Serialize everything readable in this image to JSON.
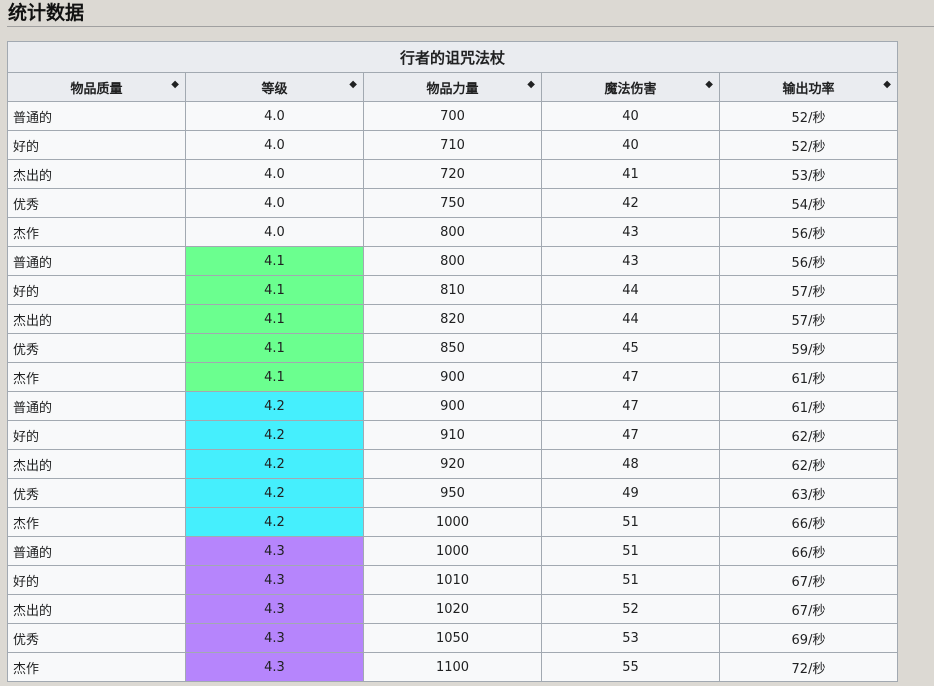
{
  "section_title": "统计数据",
  "table": {
    "title": "行者的诅咒法杖",
    "headers": [
      "物品质量",
      "等级",
      "物品力量",
      "魔法伤害",
      "输出功率"
    ],
    "level_colors": {
      "4.0": "",
      "4.1": "#6bff8f",
      "4.2": "#45effd",
      "4.3": "#b685fc"
    },
    "rows": [
      [
        "普通的",
        "4.0",
        "700",
        "40",
        "52/秒"
      ],
      [
        "好的",
        "4.0",
        "710",
        "40",
        "52/秒"
      ],
      [
        "杰出的",
        "4.0",
        "720",
        "41",
        "53/秒"
      ],
      [
        "优秀",
        "4.0",
        "750",
        "42",
        "54/秒"
      ],
      [
        "杰作",
        "4.0",
        "800",
        "43",
        "56/秒"
      ],
      [
        "普通的",
        "4.1",
        "800",
        "43",
        "56/秒"
      ],
      [
        "好的",
        "4.1",
        "810",
        "44",
        "57/秒"
      ],
      [
        "杰出的",
        "4.1",
        "820",
        "44",
        "57/秒"
      ],
      [
        "优秀",
        "4.1",
        "850",
        "45",
        "59/秒"
      ],
      [
        "杰作",
        "4.1",
        "900",
        "47",
        "61/秒"
      ],
      [
        "普通的",
        "4.2",
        "900",
        "47",
        "61/秒"
      ],
      [
        "好的",
        "4.2",
        "910",
        "47",
        "62/秒"
      ],
      [
        "杰出的",
        "4.2",
        "920",
        "48",
        "62/秒"
      ],
      [
        "优秀",
        "4.2",
        "950",
        "49",
        "63/秒"
      ],
      [
        "杰作",
        "4.2",
        "1000",
        "51",
        "66/秒"
      ],
      [
        "普通的",
        "4.3",
        "1000",
        "51",
        "66/秒"
      ],
      [
        "好的",
        "4.3",
        "1010",
        "51",
        "67/秒"
      ],
      [
        "杰出的",
        "4.3",
        "1020",
        "52",
        "67/秒"
      ],
      [
        "优秀",
        "4.3",
        "1050",
        "53",
        "69/秒"
      ],
      [
        "杰作",
        "4.3",
        "1100",
        "55",
        "72/秒"
      ]
    ]
  }
}
